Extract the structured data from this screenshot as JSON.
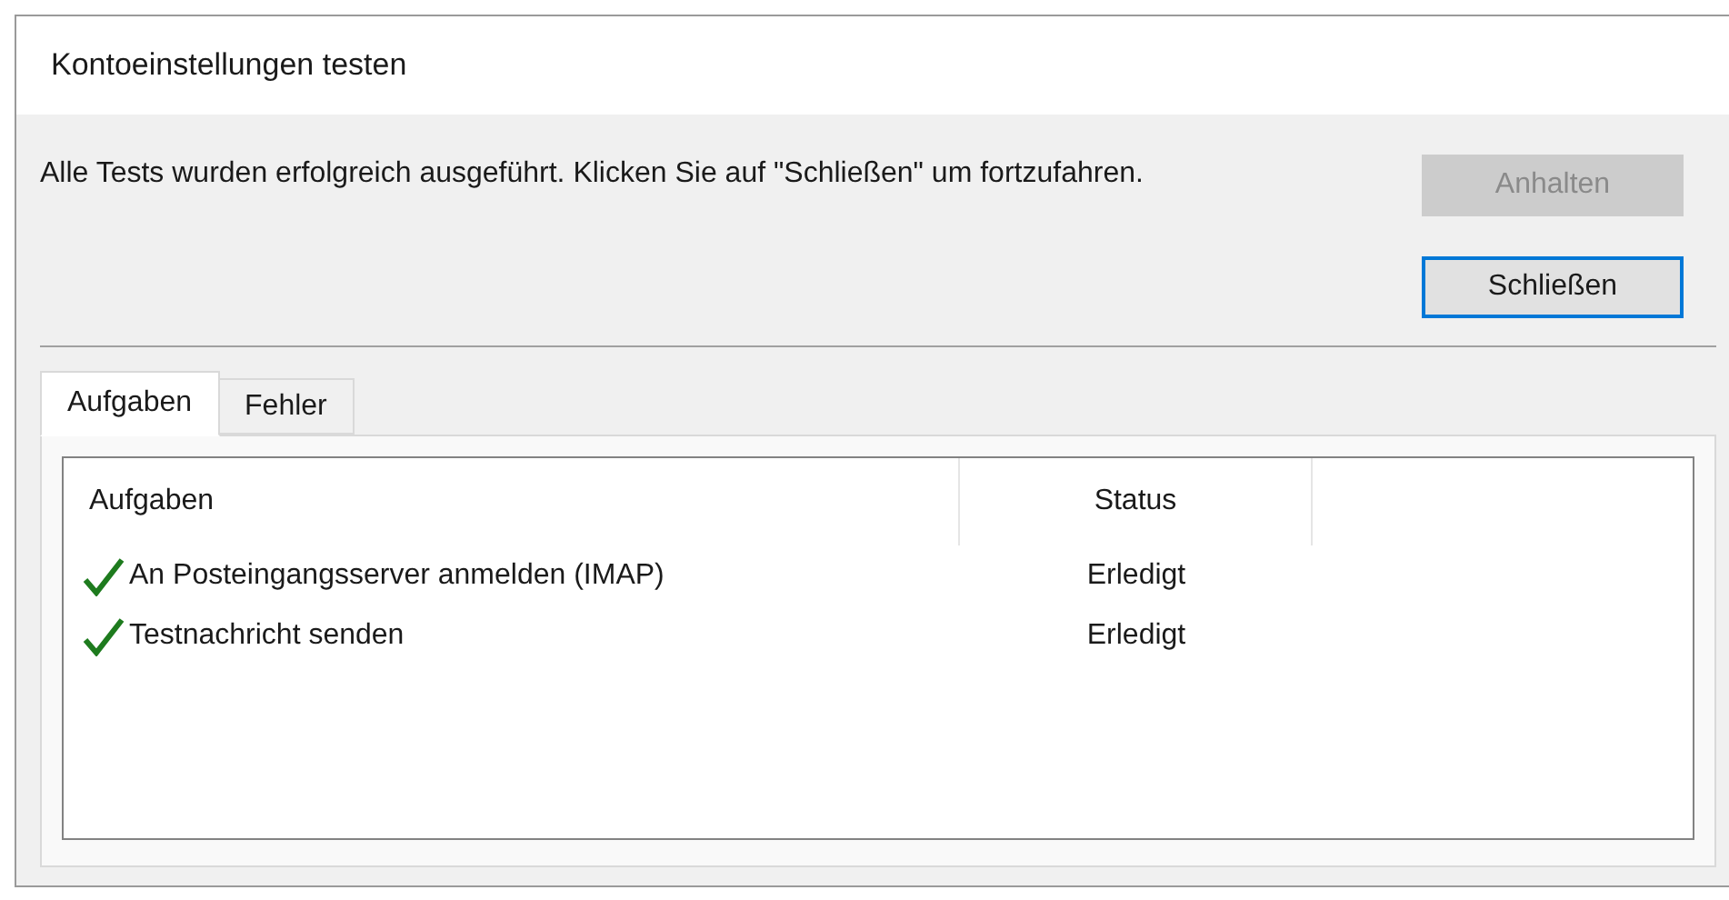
{
  "window": {
    "title": "Kontoeinstellungen testen"
  },
  "message": "Alle Tests wurden erfolgreich ausgeführt. Klicken Sie auf \"Schließen\" um fortzufahren.",
  "buttons": [
    {
      "label": "Anhalten",
      "disabled": true,
      "default": false
    },
    {
      "label": "Schließen",
      "disabled": false,
      "default": true
    }
  ],
  "tabs": [
    {
      "label": "Aufgaben",
      "selected": true
    },
    {
      "label": "Fehler",
      "selected": false
    }
  ],
  "table": {
    "columns": [
      "Aufgaben",
      "Status"
    ],
    "rows": [
      {
        "task": "An Posteingangsserver anmelden (IMAP)",
        "status": "Erledigt",
        "done": true
      },
      {
        "task": "Testnachricht senden",
        "status": "Erledigt",
        "done": true
      }
    ]
  }
}
